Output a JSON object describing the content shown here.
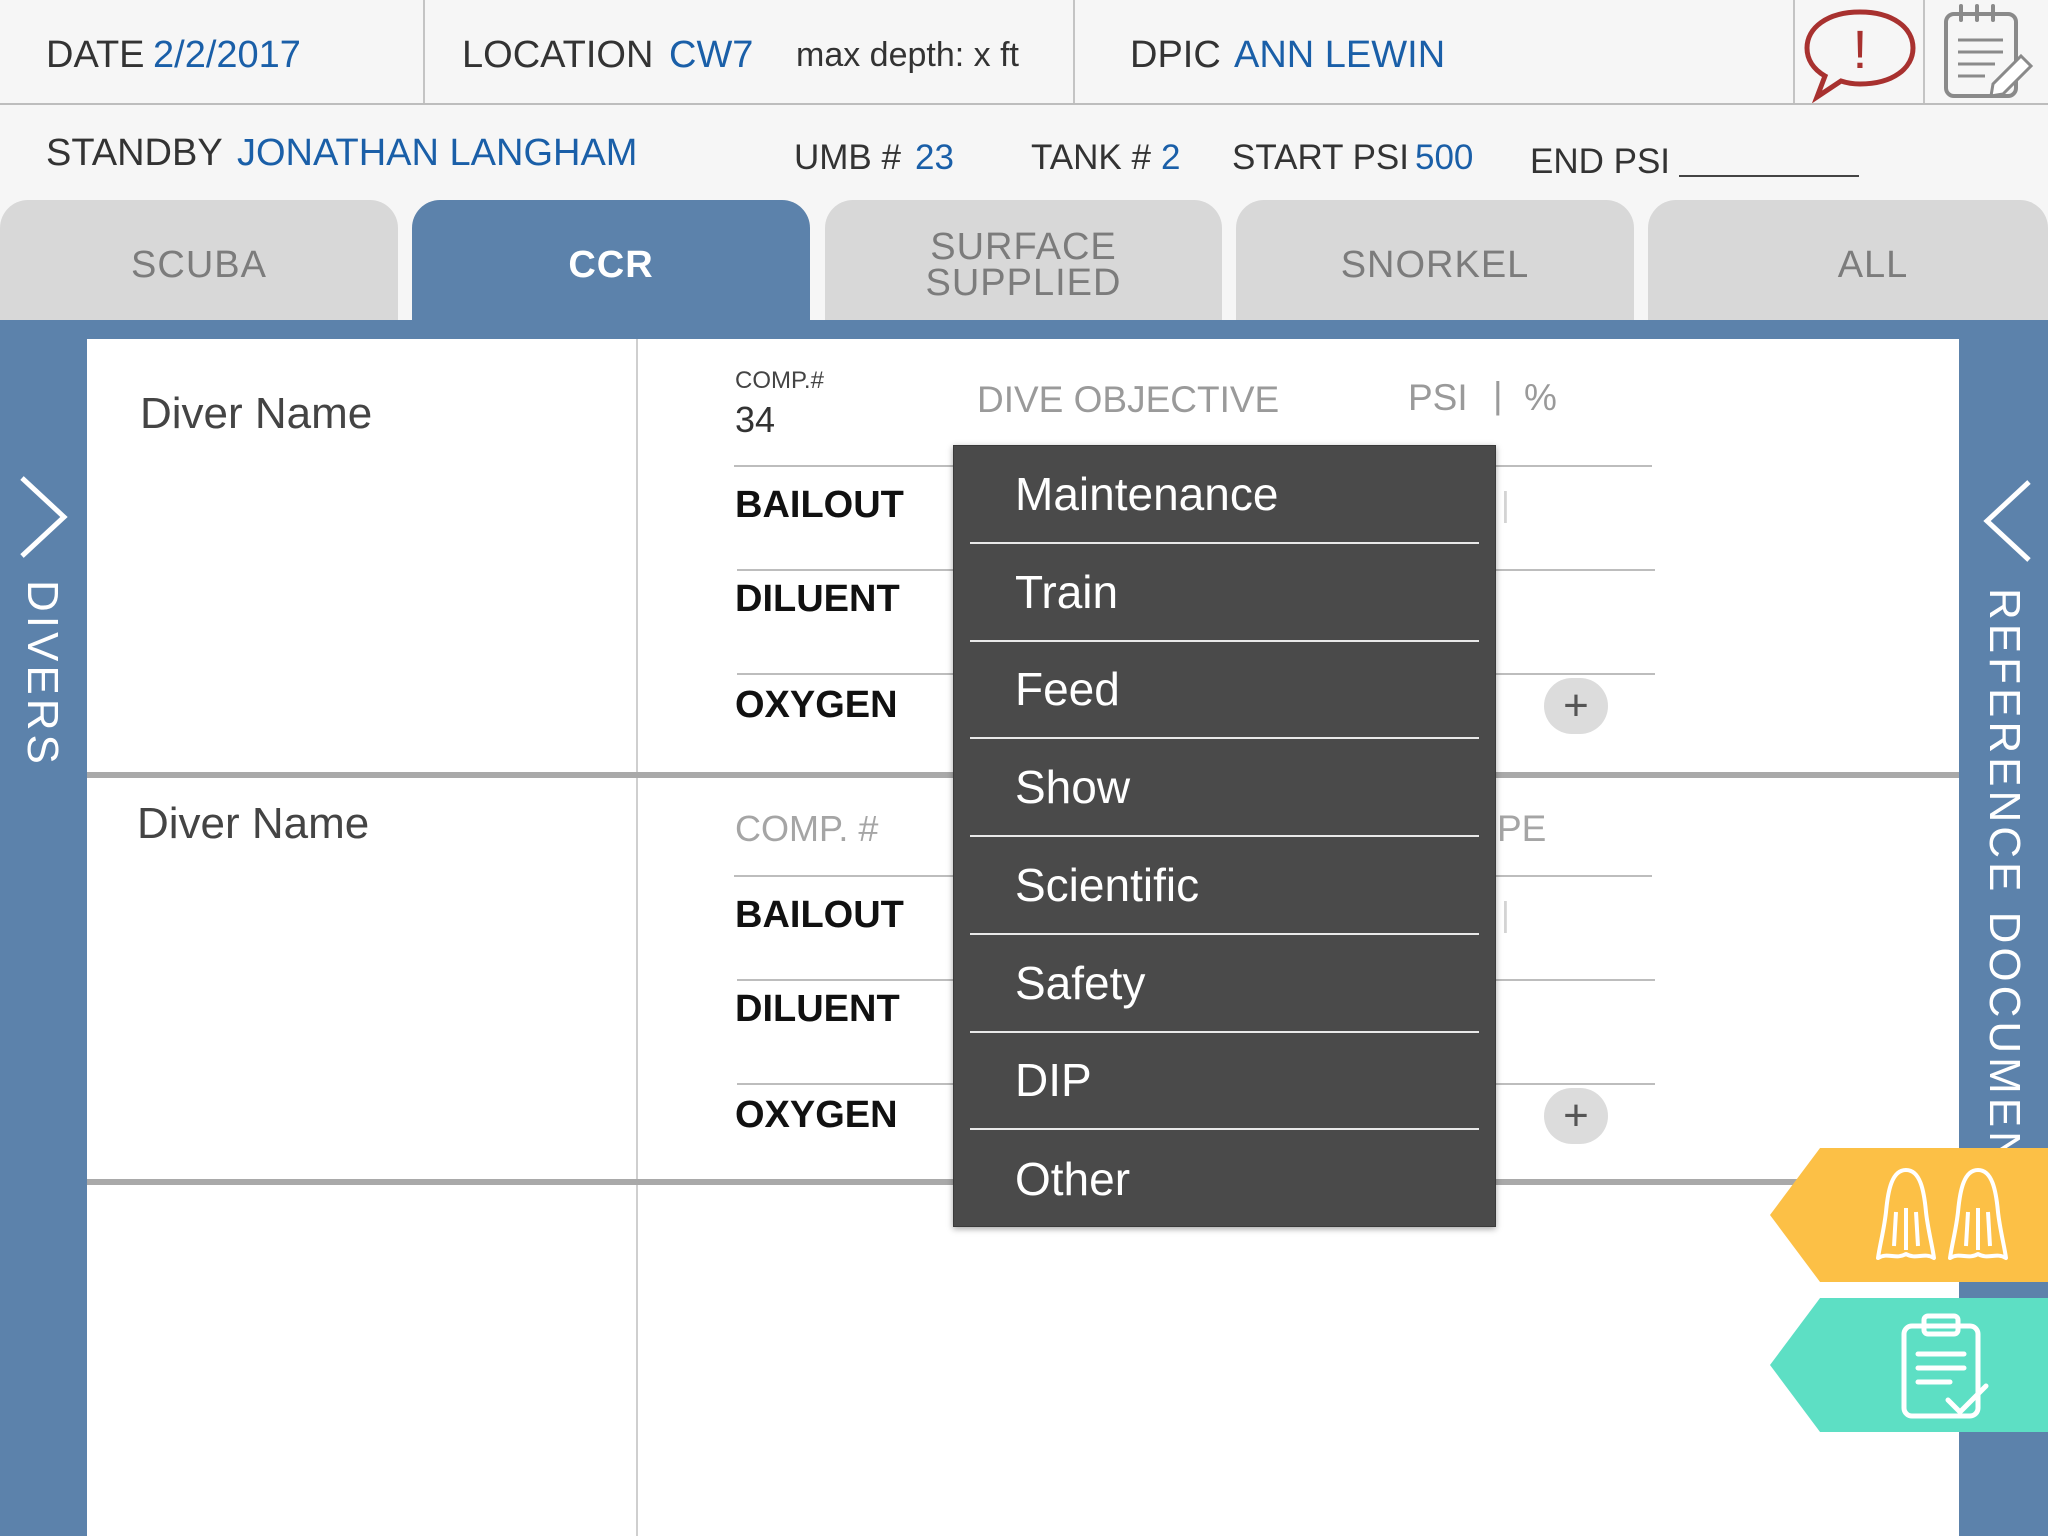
{
  "header": {
    "date_label": "DATE",
    "date_value": "2/2/2017",
    "location_label": "LOCATION",
    "location_value": "CW7",
    "max_depth": "max depth: x ft",
    "dpic_label": "DPIC",
    "dpic_value": "ANN LEWIN",
    "alert_symbol": "!",
    "alert_icon": "speech-bubble-exclamation-icon",
    "notes_icon": "notepad-pencil-icon"
  },
  "row2": {
    "standby_label": "STANDBY",
    "standby_value": "JONATHAN LANGHAM",
    "umb_label": "UMB #",
    "umb_value": "23",
    "tank_label": "TANK #",
    "tank_value": "2",
    "start_psi_label": "START PSI",
    "start_psi_value": "500",
    "end_psi_label": "END PSI",
    "end_psi_value": ""
  },
  "tabs": [
    {
      "label": "SCUBA",
      "active": false
    },
    {
      "label": "CCR",
      "active": true
    },
    {
      "label": "SURFACE SUPPLIED",
      "active": false
    },
    {
      "label": "SNORKEL",
      "active": false
    },
    {
      "label": "ALL",
      "active": false
    }
  ],
  "left_rail": {
    "label": "DIVERS",
    "icon": "chevron-right-icon"
  },
  "right_rail": {
    "label": "REFERENCE DOCUMENTS",
    "icon": "chevron-left-icon"
  },
  "divers": [
    {
      "name_placeholder": "Diver Name",
      "comp_label": "COMP.#",
      "comp_value": "34",
      "objective_placeholder": "DIVE OBJECTIVE",
      "psi_label": "PSI",
      "pct_label": "%",
      "gas_rows": [
        "BAILOUT",
        "DILUENT",
        "OXYGEN"
      ],
      "add_label": "+"
    },
    {
      "name_placeholder": "Diver Name",
      "comp_placeholder": "COMP. #",
      "type_partial": "PE",
      "gas_rows": [
        "BAILOUT",
        "DILUENT",
        "OXYGEN"
      ],
      "add_label": "+"
    }
  ],
  "dive_objective_menu": {
    "options": [
      "Maintenance",
      "Train",
      "Feed",
      "Show",
      "Scientific",
      "Safety",
      "DIP",
      "Other"
    ]
  },
  "side_flags": [
    {
      "name": "fins",
      "icon": "fins-icon",
      "color": "#fcc046"
    },
    {
      "name": "checklist",
      "icon": "clipboard-check-icon",
      "color": "#5ddfc4"
    }
  ],
  "colors": {
    "accent_blue": "#5c82ab",
    "value_blue": "#1a5fa8",
    "alert_red": "#a8312f",
    "menu_bg": "#4a4a4a",
    "fins_flag": "#fcc046",
    "checklist_flag": "#5ddfc4"
  }
}
